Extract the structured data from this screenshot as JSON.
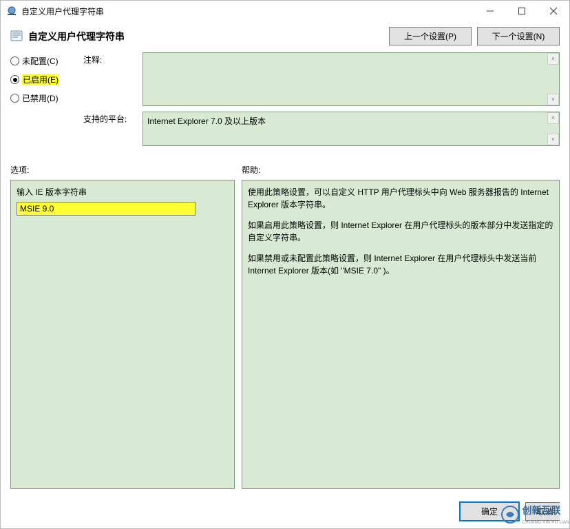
{
  "titlebar": {
    "title": "自定义用户代理字符串"
  },
  "header": {
    "title": "自定义用户代理字符串",
    "prev": "上一个设置(P)",
    "next": "下一个设置(N)"
  },
  "radios": {
    "not_configured": "未配置(C)",
    "enabled": "已启用(E)",
    "disabled": "已禁用(D)"
  },
  "fields": {
    "comment_label": "注释:",
    "comment_value": "",
    "platforms_label": "支持的平台:",
    "platforms_value": "Internet Explorer 7.0 及以上版本"
  },
  "sections": {
    "options": "选项:",
    "help": "帮助:"
  },
  "options": {
    "input_label": "输入 IE 版本字符串",
    "input_value": "MSIE 9.0"
  },
  "help": {
    "p1": "使用此策略设置，可以自定义 HTTP 用户代理标头中向 Web 服务器报告的 Internet Explorer 版本字符串。",
    "p2": "如果启用此策略设置，则 Internet Explorer 在用户代理标头的版本部分中发送指定的自定义字符串。",
    "p3": "如果禁用或未配置此策略设置，则 Internet Explorer 在用户代理标头中发送当前 Internet Explorer 版本(如 \"MSIE 7.0\" )。"
  },
  "footer": {
    "ok": "确定",
    "cancel": "取消"
  },
  "watermark": {
    "brand": "创新互联",
    "sub": "CHUANG XIN HU LIAN"
  }
}
